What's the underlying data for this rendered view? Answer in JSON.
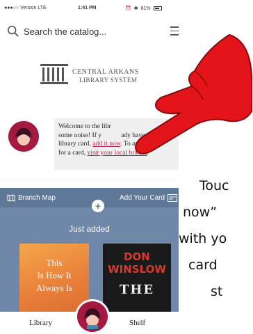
{
  "status_bar": {
    "carrier": "●●●○○ Verizon  LTE",
    "time": "1:41 PM",
    "battery": "61%"
  },
  "search": {
    "placeholder": "Search the catalog..."
  },
  "logo": {
    "line1": "CENTRAL ARKANS",
    "line2": "LIBRARY SYSTEM"
  },
  "welcome": {
    "text_before": "Welcome to the libr",
    "text_mid1": "some noise! If y",
    "text_mid1b": "ady have a",
    "text_line3_pre": "library card, ",
    "link_add": "add it now",
    "text_line3_post": ". To apply",
    "text_line4_pre": "for a card, ",
    "link_branch": "visit your local branch",
    "text_line4_post": "."
  },
  "panel": {
    "branch_map": "Branch Map",
    "add_card": "Add Your Card",
    "plus": "+",
    "just_added": "Just added"
  },
  "books": [
    {
      "lines": [
        "This",
        "Is How It",
        "Always Is"
      ]
    },
    {
      "lines": [
        "DON",
        "WINSLOW",
        "THE"
      ]
    }
  ],
  "tabs": {
    "library": "Library",
    "shelf": "Shelf"
  },
  "instruction": {
    "lines": [
      "Touc",
      "now”",
      "with yo",
      "card",
      "st"
    ]
  },
  "colors": {
    "accent": "#c02552",
    "avatar": "#a5183f",
    "panel": "#6f87a9",
    "hand": "#e3141a"
  }
}
